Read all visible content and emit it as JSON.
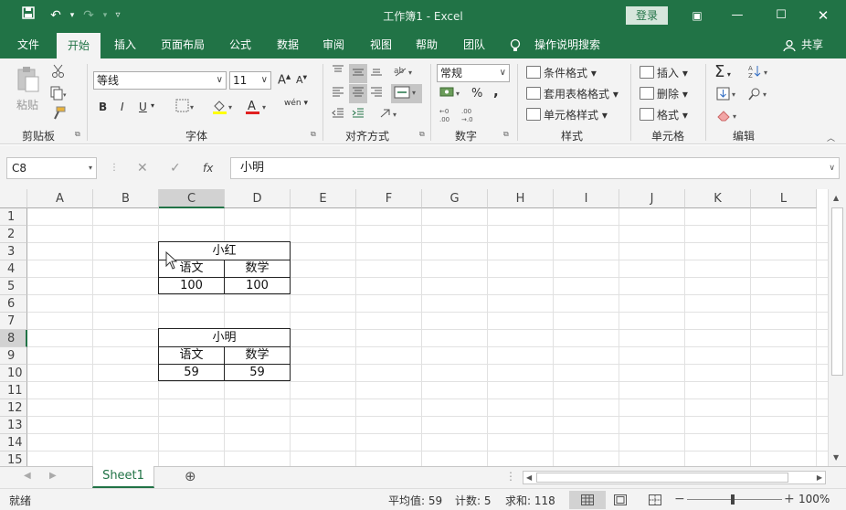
{
  "window": {
    "title": "工作簿1  -  Excel",
    "login_label": "登录"
  },
  "menu": {
    "tabs": [
      {
        "label": "文件"
      },
      {
        "label": "开始"
      },
      {
        "label": "插入"
      },
      {
        "label": "页面布局"
      },
      {
        "label": "公式"
      },
      {
        "label": "数据"
      },
      {
        "label": "审阅"
      },
      {
        "label": "视图"
      },
      {
        "label": "帮助"
      },
      {
        "label": "团队"
      }
    ],
    "search_label": "操作说明搜索",
    "share_label": "共享"
  },
  "ribbon": {
    "clipboard": {
      "paste": "粘贴",
      "label": "剪贴板"
    },
    "font": {
      "name": "等线",
      "size": "11",
      "label": "字体",
      "bold": "B",
      "italic": "I",
      "underline": "U",
      "grow": "A",
      "shrink": "A",
      "phonetic": "wén"
    },
    "alignment": {
      "label": "对齐方式"
    },
    "number": {
      "format": "常规",
      "label": "数字",
      "percent": "%",
      "comma": ","
    },
    "styles": {
      "conditional": "条件格式",
      "table": "套用表格格式",
      "cell": "单元格样式",
      "label": "样式"
    },
    "cells": {
      "insert": "插入",
      "delete": "删除",
      "format": "格式",
      "label": "单元格"
    },
    "editing": {
      "label": "编辑"
    }
  },
  "formula_bar": {
    "name_box": "C8",
    "fx": "fx",
    "value": "小明"
  },
  "grid": {
    "columns": [
      "A",
      "B",
      "C",
      "D",
      "E",
      "F",
      "G",
      "H",
      "I",
      "J",
      "K",
      "L"
    ],
    "rows": [
      "1",
      "2",
      "3",
      "4",
      "5",
      "6",
      "7",
      "8",
      "9",
      "10",
      "11",
      "12",
      "13",
      "14",
      "15"
    ],
    "table1": {
      "title": "小红",
      "headers": [
        "语文",
        "数学"
      ],
      "values": [
        "100",
        "100"
      ]
    },
    "table2": {
      "title": "小明",
      "headers": [
        "语文",
        "数学"
      ],
      "values": [
        "59",
        "59"
      ]
    }
  },
  "sheets": {
    "tabs": [
      "Sheet1"
    ]
  },
  "status": {
    "ready": "就绪",
    "average": "平均值: 59",
    "count": "计数: 5",
    "sum": "求和: 118",
    "zoom": "100%"
  },
  "colors": {
    "brand": "#217346",
    "ribbon_bg": "#f3f3f3"
  }
}
